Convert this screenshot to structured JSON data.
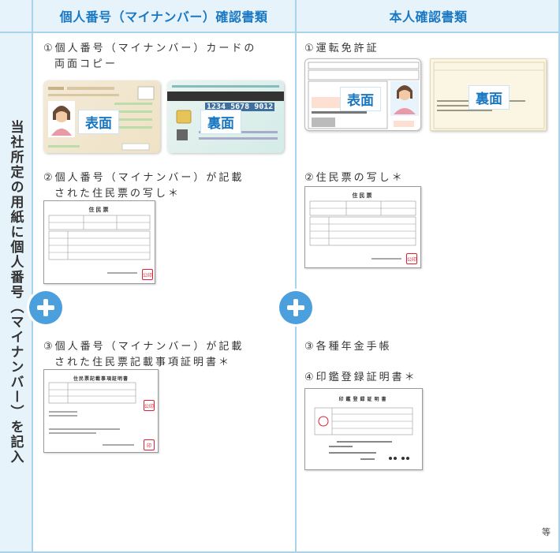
{
  "header": {
    "col1": "個人番号（マイナンバー）確認書類",
    "col2": "本人確認書類"
  },
  "side_label": "当社所定の用紙に個人番号（マイナンバー）を記入",
  "left": {
    "item1_line1": "①個人番号（マイナンバー）カードの",
    "item1_line2": "両面コピー",
    "card_front": "表面",
    "card_back": "裏面",
    "card_number": "1234 5678 9012",
    "item2_line1": "②個人番号（マイナンバー）が記載",
    "item2_line2": "された住民票の写し＊",
    "doc1_title": "住民票",
    "item3_line1": "③個人番号（マイナンバー）が記載",
    "item3_line2": "された住民票記載事項証明書＊",
    "doc2_title": "住民票記載事項証明書"
  },
  "right": {
    "item1": "①運転免許証",
    "license_front": "表面",
    "license_back": "裏面",
    "item2": "②住民票の写し＊",
    "doc1_title": "住民票",
    "item3": "③各種年金手帳",
    "item4": "④印鑑登録証明書＊",
    "doc2_title": "印鑑登録証明書"
  },
  "seal_text": "公印",
  "seal_text2": "印",
  "footer_etc": "等",
  "colors": {
    "accent": "#1a78c2",
    "header_bg": "#e6f3fb",
    "line": "#a9d3ec",
    "plus": "#4a9fdc"
  }
}
